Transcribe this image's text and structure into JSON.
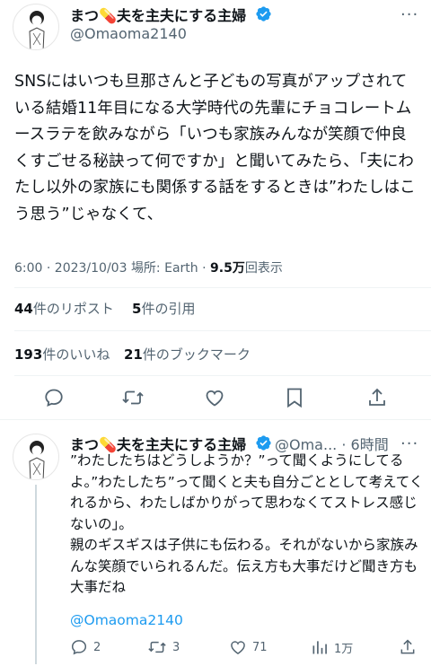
{
  "main_tweet": {
    "author_name": "まつ💊夫を主夫にする主婦",
    "handle": "@Omaoma2140",
    "text": "SNSにはいつも旦那さんと子どもの写真がアップされている結婚11年目になる大学時代の先輩にチョコレートムースラテを飲みながら「いつも家族みんなが笑顔で仲良くすごせる秘訣って何ですか」と聞いてみたら、「夫にわたし以外の家族にも関係する話をするときは”わたしはこう思う”じゃなくて、",
    "time": "6:00 · 2023/10/03",
    "location_prefix": "場所:",
    "location": "Earth",
    "views": "9.5万",
    "views_label": "回表示",
    "reposts_count": "44",
    "reposts_label": "件のリポスト",
    "quotes_count": "5",
    "quotes_label": "件の引用",
    "likes_count": "193",
    "likes_label": "件のいいね",
    "bookmarks_count": "21",
    "bookmarks_label": "件のブックマーク"
  },
  "reply_tweet": {
    "author_name": "まつ💊夫を主夫にする主婦",
    "handle": "@Oma...",
    "time": "6時間",
    "text": "”わたしたちはどうしようか？”って聞くようにしてるよ。”わたしたち”って聞くと夫も自分ごととして考えてくれるから、わたしばかりがって思わなくてストレス感じないの」。\n親のギスギスは子供にも伝わる。それがないから家族みんな笑顔でいられるんだ。伝え方も大事だけど聞き方も大事だね",
    "mention": "@Omaoma2140",
    "reply_count": "2",
    "repost_count": "3",
    "like_count": "71",
    "view_count": "1万"
  },
  "colors": {
    "verified": "#1d9bf0",
    "secondary_text": "#536471",
    "link": "#1d9bf0",
    "divider": "#eff3f4"
  }
}
